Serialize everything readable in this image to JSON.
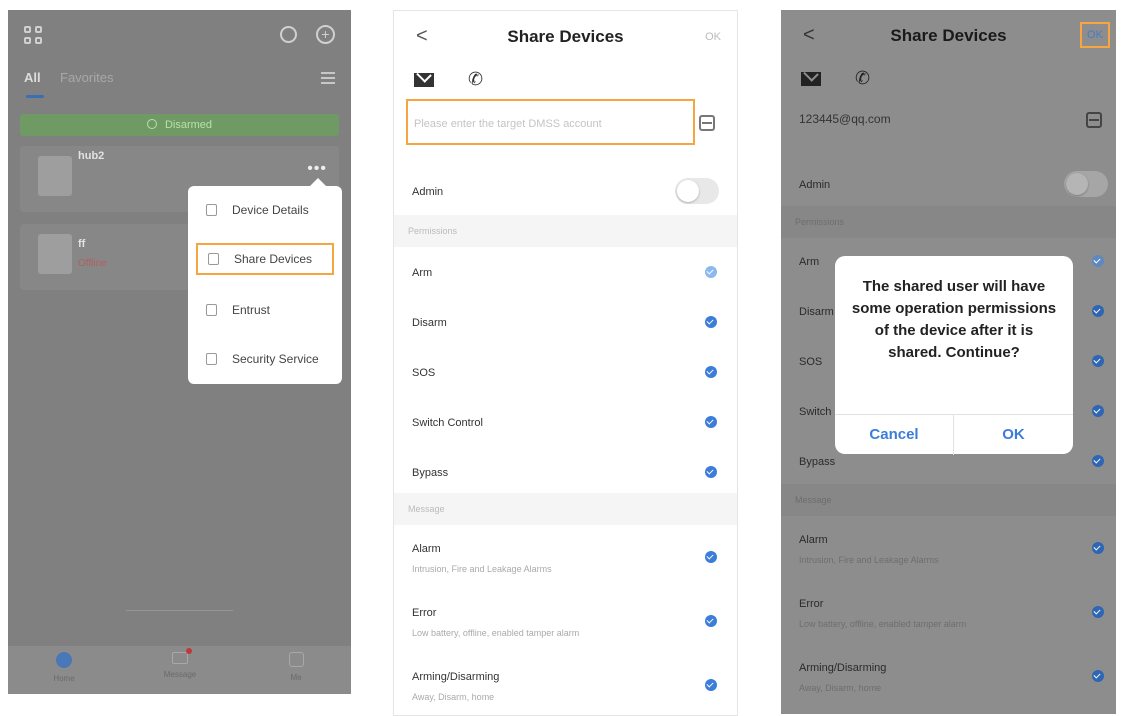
{
  "panel1": {
    "tabs": {
      "all": "All",
      "favorites": "Favorites"
    },
    "status": "Disarmed",
    "devices": [
      {
        "name": "hub2",
        "sub": ""
      },
      {
        "name": "ff",
        "sub": "Offline"
      }
    ],
    "menu": [
      "Device Details",
      "Share Devices",
      "Entrust",
      "Security Service"
    ],
    "nav": [
      "Home",
      "Message",
      "Me"
    ]
  },
  "panel2": {
    "title": "Share Devices",
    "back": "<",
    "ok": "OK",
    "account_placeholder": "Please enter the target DMSS account",
    "admin_label": "Admin",
    "permissions_header": "Permissions",
    "permissions": [
      "Arm",
      "Disarm",
      "SOS",
      "Switch Control",
      "Bypass"
    ],
    "message_header": "Message",
    "messages": [
      {
        "label": "Alarm",
        "desc": "Intrusion, Fire and Leakage Alarms"
      },
      {
        "label": "Error",
        "desc": "Low battery, offline, enabled tamper alarm"
      },
      {
        "label": "Arming/Disarming",
        "desc": "Away, Disarm, home"
      }
    ]
  },
  "panel3": {
    "title": "Share Devices",
    "back": "<",
    "ok": "OK",
    "account_value": "123445@qq.com",
    "admin_label": "Admin",
    "permissions_header": "Permissions",
    "permissions": [
      "Arm",
      "Disarm",
      "SOS",
      "Switch",
      "Bypass"
    ],
    "message_header": "Message",
    "messages": [
      {
        "label": "Alarm",
        "desc": "Intrusion, Fire and Leakage Alarms"
      },
      {
        "label": "Error",
        "desc": "Low battery, offline, enabled tamper alarm"
      },
      {
        "label": "Arming/Disarming",
        "desc": "Away, Disarm, home"
      }
    ],
    "dialog": {
      "message": "The shared user will have some operation permissions of the device after it is shared. Continue?",
      "cancel": "Cancel",
      "ok": "OK"
    }
  },
  "colors": {
    "accent": "#3b7dd8",
    "highlight": "#f5a641",
    "armed_green": "#6f9a64"
  },
  "icons": [
    "grid-icon",
    "search-icon",
    "add-icon",
    "list-menu-icon",
    "more-icon",
    "device-details-icon",
    "share-icon",
    "entrust-icon",
    "security-service-icon",
    "home-icon",
    "message-icon",
    "me-icon",
    "back-icon",
    "mail-icon",
    "phone-icon",
    "scan-icon",
    "check-icon"
  ]
}
